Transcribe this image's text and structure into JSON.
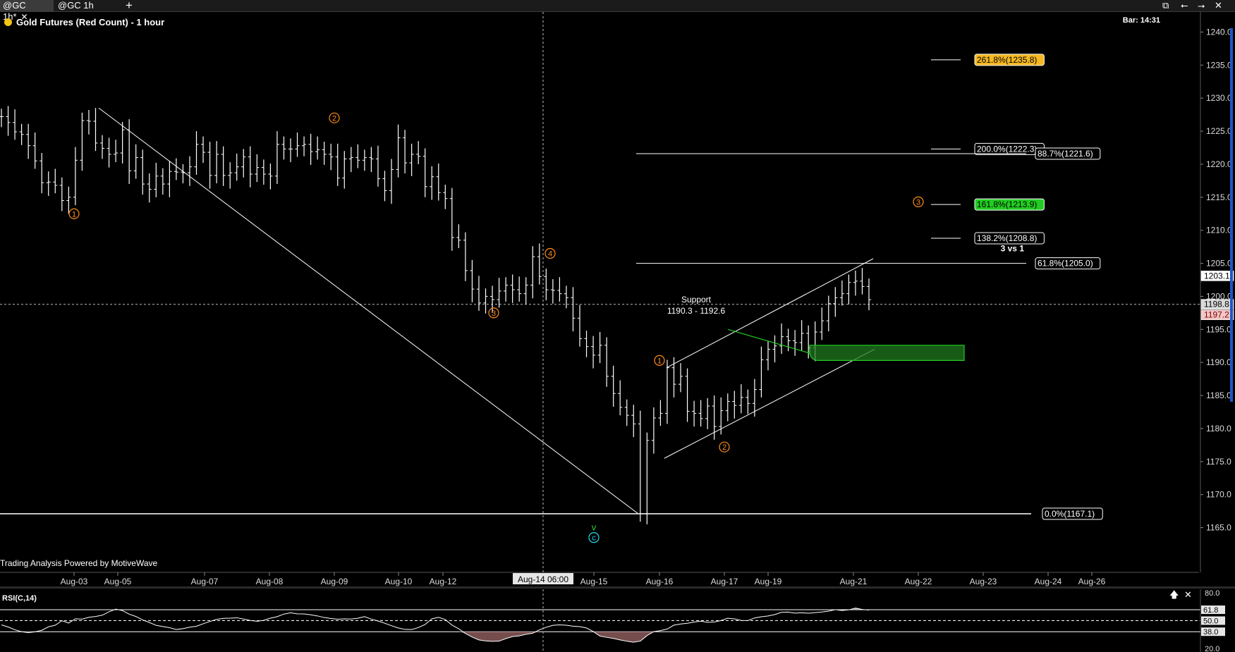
{
  "tabs": [
    {
      "label": "@GC 1h*",
      "active": true
    },
    {
      "label": "@GC 1h",
      "active": false
    }
  ],
  "window_controls": [
    "pin-icon",
    "back-arrow-icon",
    "forward-arrow-icon",
    "close-icon"
  ],
  "chart": {
    "title": "Gold Futures (Red Count) - 1 hour",
    "bar_readout": "Bar: 14:31",
    "watermark": "Trading Analysis Powered by MotiveWave",
    "crosshair_date": "Aug-14 06:00",
    "support_label": "Support",
    "support_range": "1190.3 - 1192.6",
    "three_vs_one": "3 vs 1",
    "colors": {
      "background": "#000000",
      "bars": "#ffffff",
      "wave_label": "#ff8c1a",
      "fib_gold": "#f5b820",
      "fib_green": "#22cc22",
      "support_zone": "#1f7a1f",
      "current_price_tag": "#d9d9d9",
      "bid_tag": "#f2c7c7"
    }
  },
  "chart_data": {
    "type": "candlestick-ohlc-bars",
    "symbol": "@GC",
    "interval": "1 hour",
    "x_labels": [
      "Aug-03",
      "Aug-05",
      "Aug-07",
      "Aug-08",
      "Aug-09",
      "Aug-10",
      "Aug-12",
      "Aug-14 06:00",
      "Aug-15",
      "Aug-16",
      "Aug-17",
      "Aug-19",
      "Aug-21",
      "Aug-22",
      "Aug-23",
      "Aug-24",
      "Aug-26"
    ],
    "y_ticks": [
      "1240.0",
      "1235.0",
      "1230.0",
      "1225.0",
      "1220.0",
      "1215.0",
      "1210.0",
      "1205.0",
      "1200.0",
      "1195.0",
      "1190.0",
      "1185.0",
      "1180.0",
      "1175.0",
      "1170.0",
      "1165.0"
    ],
    "ylim": [
      1162.5,
      1242.5
    ],
    "price_tags": [
      {
        "label": "1203.1",
        "value": 1203.1
      },
      {
        "label": "1198.8",
        "value": 1198.8
      },
      {
        "label": "1197.2",
        "value": 1197.2
      }
    ],
    "fib_levels": [
      {
        "label": "261.8%(1235.8)",
        "value": 1235.8,
        "style": "gold"
      },
      {
        "label": "200.0%(1222.3)",
        "value": 1222.3,
        "style": "outline"
      },
      {
        "label": "88.7%(1221.6)",
        "value": 1221.6,
        "style": "outline"
      },
      {
        "label": "161.8%(1213.9)",
        "value": 1213.9,
        "style": "green"
      },
      {
        "label": "138.2%(1208.8)",
        "value": 1208.8,
        "style": "outline"
      },
      {
        "label": "61.8%(1205.0)",
        "value": 1205.0,
        "style": "outline"
      },
      {
        "label": "0.0%(1167.1)",
        "value": 1167.1,
        "style": "outline"
      }
    ],
    "wave_labels": [
      {
        "label": "1",
        "date": "Aug-03",
        "value": 1212.5,
        "color": "orange"
      },
      {
        "label": "2",
        "date": "Aug-09",
        "value": 1227.0,
        "color": "orange"
      },
      {
        "label": "3",
        "date": "Aug-13",
        "value": 1197.5,
        "color": "orange"
      },
      {
        "label": "4",
        "date": "Aug-14",
        "value": 1206.5,
        "color": "orange"
      },
      {
        "label": "v",
        "date": "Aug-15",
        "value": 1165.0,
        "color": "green"
      },
      {
        "label": "c",
        "date": "Aug-15",
        "value": 1163.5,
        "color": "cyan"
      },
      {
        "label": "1",
        "date": "Aug-16",
        "value": 1190.3,
        "color": "orange"
      },
      {
        "label": "2",
        "date": "Aug-17",
        "value": 1177.2,
        "color": "orange"
      },
      {
        "label": "3",
        "date": "Aug-22",
        "value": 1214.3,
        "color": "orange"
      }
    ],
    "price_series": [
      1227.2,
      1226.3,
      1224.9,
      1224.5,
      1222.8,
      1220.5,
      1217.2,
      1217.3,
      1216.8,
      1214.5,
      1215.0,
      1220.6,
      1226.6,
      1226.5,
      1223.2,
      1222.4,
      1221.5,
      1221.7,
      1225.2,
      1219.0,
      1221.0,
      1217.0,
      1216.2,
      1218.2,
      1217.0,
      1218.9,
      1218.8,
      1218.7,
      1219.6,
      1223.0,
      1221.8,
      1218.3,
      1221.5,
      1218.3,
      1218.7,
      1219.6,
      1221.1,
      1218.5,
      1219.5,
      1218.5,
      1218.2,
      1223.0,
      1222.3,
      1222.3,
      1222.8,
      1223.0,
      1221.9,
      1222.2,
      1221.5,
      1221.1,
      1217.9,
      1220.8,
      1221.0,
      1220.6,
      1221.0,
      1220.8,
      1217.8,
      1216.0,
      1219.2,
      1224.0,
      1220.2,
      1221.5,
      1221.2,
      1216.6,
      1218.1,
      1215.7,
      1214.8,
      1208.9,
      1208.5,
      1203.9,
      1201.1,
      1199.0,
      1200.0,
      1199.5,
      1200.8,
      1201.7,
      1201.0,
      1200.4,
      1201.7,
      1206.0,
      1203.0,
      1201.0,
      1200.9,
      1200.4,
      1199.8,
      1196.7,
      1193.6,
      1192.4,
      1191.1,
      1192.6,
      1187.9,
      1185.3,
      1183.2,
      1182.0,
      1180.7,
      1167.1,
      1178.2,
      1181.6,
      1182.3,
      1189.2,
      1186.7,
      1187.9,
      1182.6,
      1182.3,
      1181.5,
      1183.4,
      1180.3,
      1182.7,
      1184.1,
      1183.5,
      1184.7,
      1183.8,
      1185.9,
      1190.4,
      1192.0,
      1192.5,
      1193.9,
      1193.3,
      1193.0,
      1194.4,
      1192.2,
      1194.6,
      1196.3,
      1198.9,
      1199.8,
      1200.4,
      1202.1,
      1202.3,
      1201.5,
      1199.5
    ],
    "series_start": "Aug-03",
    "series_end": "Aug-21"
  },
  "rsi": {
    "label": "RSI(C,14)",
    "ticks": [
      {
        "label": "80.0",
        "value": 80.0,
        "tagged": false
      },
      {
        "label": "61.8",
        "value": 61.8,
        "tagged": true
      },
      {
        "label": "50.0",
        "value": 50.0,
        "tagged": true
      },
      {
        "label": "38.0",
        "value": 38.0,
        "tagged": true
      },
      {
        "label": "20.0",
        "value": 20.0,
        "tagged": false
      }
    ],
    "ylim": [
      16,
      84
    ],
    "series": [
      45.4,
      43.1,
      40.1,
      38.0,
      36.9,
      37.9,
      39.5,
      43.3,
      45.0,
      49.9,
      47.4,
      52.0,
      51.6,
      53.6,
      54.5,
      55.9,
      59.6,
      62.5,
      60.9,
      57.0,
      54.5,
      50.8,
      48.0,
      44.9,
      43.6,
      42.4,
      40.4,
      41.3,
      42.9,
      43.9,
      46.6,
      49.1,
      51.3,
      52.5,
      52.7,
      53.1,
      51.7,
      50.2,
      49.3,
      50.3,
      52.7,
      54.3,
      57.1,
      58.5,
      57.4,
      57.3,
      56.3,
      55.1,
      53.4,
      52.3,
      51.5,
      51.9,
      51.7,
      52.6,
      54.4,
      51.6,
      49.6,
      47.2,
      44.5,
      42.1,
      40.5,
      40.4,
      42.5,
      45.8,
      51.9,
      53.6,
      51.2,
      45.2,
      41.2,
      36.1,
      32.2,
      29.1,
      28.0,
      27.6,
      27.8,
      30.5,
      32.7,
      33.5,
      35.2,
      36.3,
      40.0,
      42.8,
      44.9,
      45.4,
      45.0,
      44.0,
      43.5,
      42.1,
      38.2,
      33.3,
      31.9,
      30.7,
      29.1,
      27.7,
      26.6,
      27.8,
      33.8,
      38.1,
      39.2,
      40.9,
      45.1,
      46.4,
      47.1,
      48.5,
      49.4,
      48.2,
      48.5,
      50.1,
      52.6,
      51.9,
      50.2,
      50.1,
      52.9,
      54.2,
      55.1,
      56.6,
      59.1,
      59.3,
      58.1,
      58.6,
      58.0,
      58.7,
      59.4,
      60.3,
      61.9,
      61.0,
      61.7,
      63.6,
      62.1,
      61.5
    ]
  }
}
